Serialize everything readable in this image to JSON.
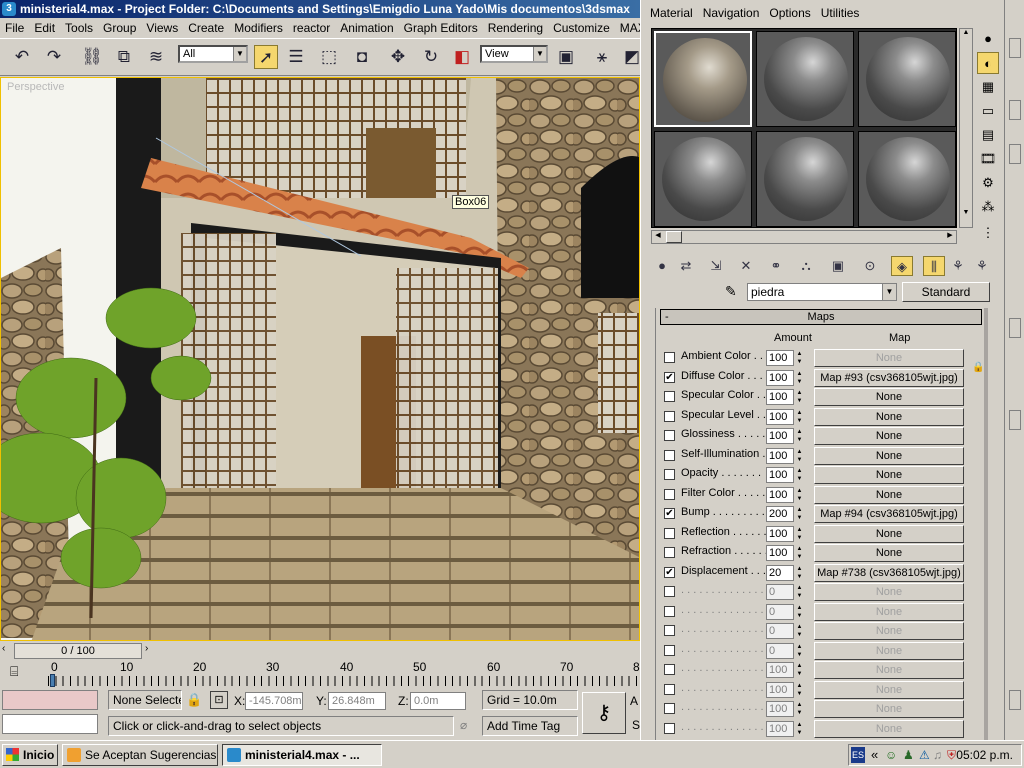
{
  "window": {
    "title": "ministerial4.max   - Project Folder: C:\\Documents and Settings\\Emigdio Luna Yado\\Mis documentos\\3dsmax",
    "app_icon": "3dsmax-icon"
  },
  "menubar": [
    "File",
    "Edit",
    "Tools",
    "Group",
    "Views",
    "Create",
    "Modifiers",
    "reactor",
    "Animation",
    "Graph Editors",
    "Rendering",
    "Customize",
    "MAXScript"
  ],
  "toolbar": {
    "selection_filter": "All",
    "reference_coord": "View",
    "icons": [
      "undo-icon",
      "redo-icon",
      "link-icon",
      "unlink-icon",
      "bind-space-warp-icon",
      "select-pointer-icon",
      "select-by-name-icon",
      "rect-selection-icon",
      "window-crossing-icon",
      "move-icon",
      "rotate-icon",
      "scale-icon",
      "pivot-icon",
      "mirror-icon",
      "snap-icon"
    ]
  },
  "viewport": {
    "label": "Perspective",
    "object_tag": "Box06"
  },
  "timeline": {
    "frame_counter": "0 / 100",
    "ticks": [
      "0",
      "10",
      "20",
      "30",
      "40",
      "50",
      "60",
      "70",
      "8"
    ],
    "current": "0"
  },
  "status": {
    "selection": "None Selecte",
    "x_label": "X:",
    "x_value": "-145.708m",
    "y_label": "Y:",
    "y_value": "26.848m",
    "z_label": "Z:",
    "z_value": "0.0m",
    "grid": "Grid = 10.0m",
    "prompt": "Click or click-and-drag to select objects",
    "add_time_tag": "Add Time Tag",
    "key_side_1": "A",
    "key_side_2": "S"
  },
  "material_editor": {
    "menu": [
      "Material",
      "Navigation",
      "Options",
      "Utilities"
    ],
    "material_name": "piedra",
    "material_type": "Standard",
    "rollout_title": "Maps",
    "rollout_collapse": "-",
    "col_amount": "Amount",
    "col_map": "Map",
    "slots": [
      {
        "kind": "stone",
        "selected": true
      },
      {
        "kind": "gray",
        "selected": false
      },
      {
        "kind": "gray",
        "selected": false
      },
      {
        "kind": "gray",
        "selected": false
      },
      {
        "kind": "gray",
        "selected": false
      },
      {
        "kind": "gray",
        "selected": false
      }
    ],
    "maps": [
      {
        "label": "Ambient Color . . .",
        "checked": false,
        "amount": "100",
        "map": "None",
        "enabled": true,
        "btn_dim": true
      },
      {
        "label": "Diffuse Color . . . .",
        "checked": true,
        "amount": "100",
        "map": "Map #93 (csv368105wjt.jpg)",
        "enabled": true,
        "btn_dim": false
      },
      {
        "label": "Specular Color . .",
        "checked": false,
        "amount": "100",
        "map": "None",
        "enabled": true,
        "btn_dim": false
      },
      {
        "label": "Specular Level . .",
        "checked": false,
        "amount": "100",
        "map": "None",
        "enabled": true,
        "btn_dim": false
      },
      {
        "label": "Glossiness . . . . .",
        "checked": false,
        "amount": "100",
        "map": "None",
        "enabled": true,
        "btn_dim": false
      },
      {
        "label": "Self-Illumination . .",
        "checked": false,
        "amount": "100",
        "map": "None",
        "enabled": true,
        "btn_dim": false
      },
      {
        "label": "Opacity . . . . . . .",
        "checked": false,
        "amount": "100",
        "map": "None",
        "enabled": true,
        "btn_dim": false
      },
      {
        "label": "Filter Color . . . . .",
        "checked": false,
        "amount": "100",
        "map": "None",
        "enabled": true,
        "btn_dim": false
      },
      {
        "label": "Bump . . . . . . . . .",
        "checked": true,
        "amount": "200",
        "map": "Map #94 (csv368105wjt.jpg)",
        "enabled": true,
        "btn_dim": false
      },
      {
        "label": "Reflection . . . . . .",
        "checked": false,
        "amount": "100",
        "map": "None",
        "enabled": true,
        "btn_dim": false
      },
      {
        "label": "Refraction . . . . . .",
        "checked": false,
        "amount": "100",
        "map": "None",
        "enabled": true,
        "btn_dim": false
      },
      {
        "label": "Displacement . . . .",
        "checked": true,
        "amount": "20",
        "map": "Map #738 (csv368105wjt.jpg)",
        "enabled": true,
        "btn_dim": false
      },
      {
        "label": ". . . . . . . . . . . . . .",
        "checked": false,
        "amount": "0",
        "map": "None",
        "enabled": false,
        "btn_dim": true
      },
      {
        "label": ". . . . . . . . . . . . . .",
        "checked": false,
        "amount": "0",
        "map": "None",
        "enabled": false,
        "btn_dim": true
      },
      {
        "label": ". . . . . . . . . . . . . .",
        "checked": false,
        "amount": "0",
        "map": "None",
        "enabled": false,
        "btn_dim": true
      },
      {
        "label": ". . . . . . . . . . . . . .",
        "checked": false,
        "amount": "0",
        "map": "None",
        "enabled": false,
        "btn_dim": true
      },
      {
        "label": ". . . . . . . . . . . . . .",
        "checked": false,
        "amount": "100",
        "map": "None",
        "enabled": false,
        "btn_dim": true
      },
      {
        "label": ". . . . . . . . . . . . . .",
        "checked": false,
        "amount": "100",
        "map": "None",
        "enabled": false,
        "btn_dim": true
      },
      {
        "label": ". . . . . . . . . . . . . .",
        "checked": false,
        "amount": "100",
        "map": "None",
        "enabled": false,
        "btn_dim": true
      },
      {
        "label": ". . . . . . . . . . . . . .",
        "checked": false,
        "amount": "100",
        "map": "None",
        "enabled": false,
        "btn_dim": true
      }
    ]
  },
  "taskbar": {
    "start": "Inicio",
    "tasks": [
      {
        "label": "Se Aceptan Sugerencias ...",
        "active": false
      },
      {
        "label": "ministerial4.max   - ...",
        "active": true
      }
    ],
    "language": "ES",
    "clock": "05:02 p.m."
  },
  "colors": {
    "title_bar": "#0a246a",
    "active_tool": "#f5d76e",
    "viewport_border": "#f0c000"
  }
}
